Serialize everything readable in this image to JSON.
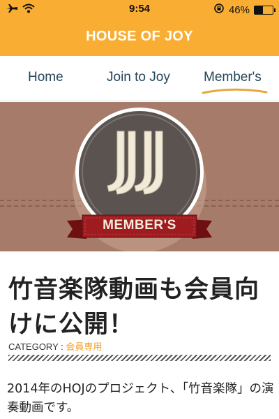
{
  "status_bar": {
    "time": "9:54",
    "battery": "46%",
    "battery_level": 0.46
  },
  "header": {
    "title": "HOUSE OF JOY"
  },
  "nav": {
    "items": [
      {
        "label": "Home"
      },
      {
        "label": "Join to Joy"
      },
      {
        "label": "Member's",
        "active": true
      }
    ]
  },
  "banner": {
    "logo_letters": "JJ",
    "ribbon_label": "MEMBER'S"
  },
  "article": {
    "title": "竹音楽隊動画も会員向けに公開！",
    "category_label": "CATEGORY : ",
    "category_value": "会員専用",
    "body": "2014年のHOJのプロジェクト、「竹音楽隊」の演奏動画です。"
  },
  "colors": {
    "header_bg": "#f9ae33",
    "nav_text": "#254559",
    "nav_active_underline": "#e6a640",
    "banner_bg": "#a77b69",
    "ribbon": "#9e1b1f",
    "category_accent": "#f2a02a"
  }
}
